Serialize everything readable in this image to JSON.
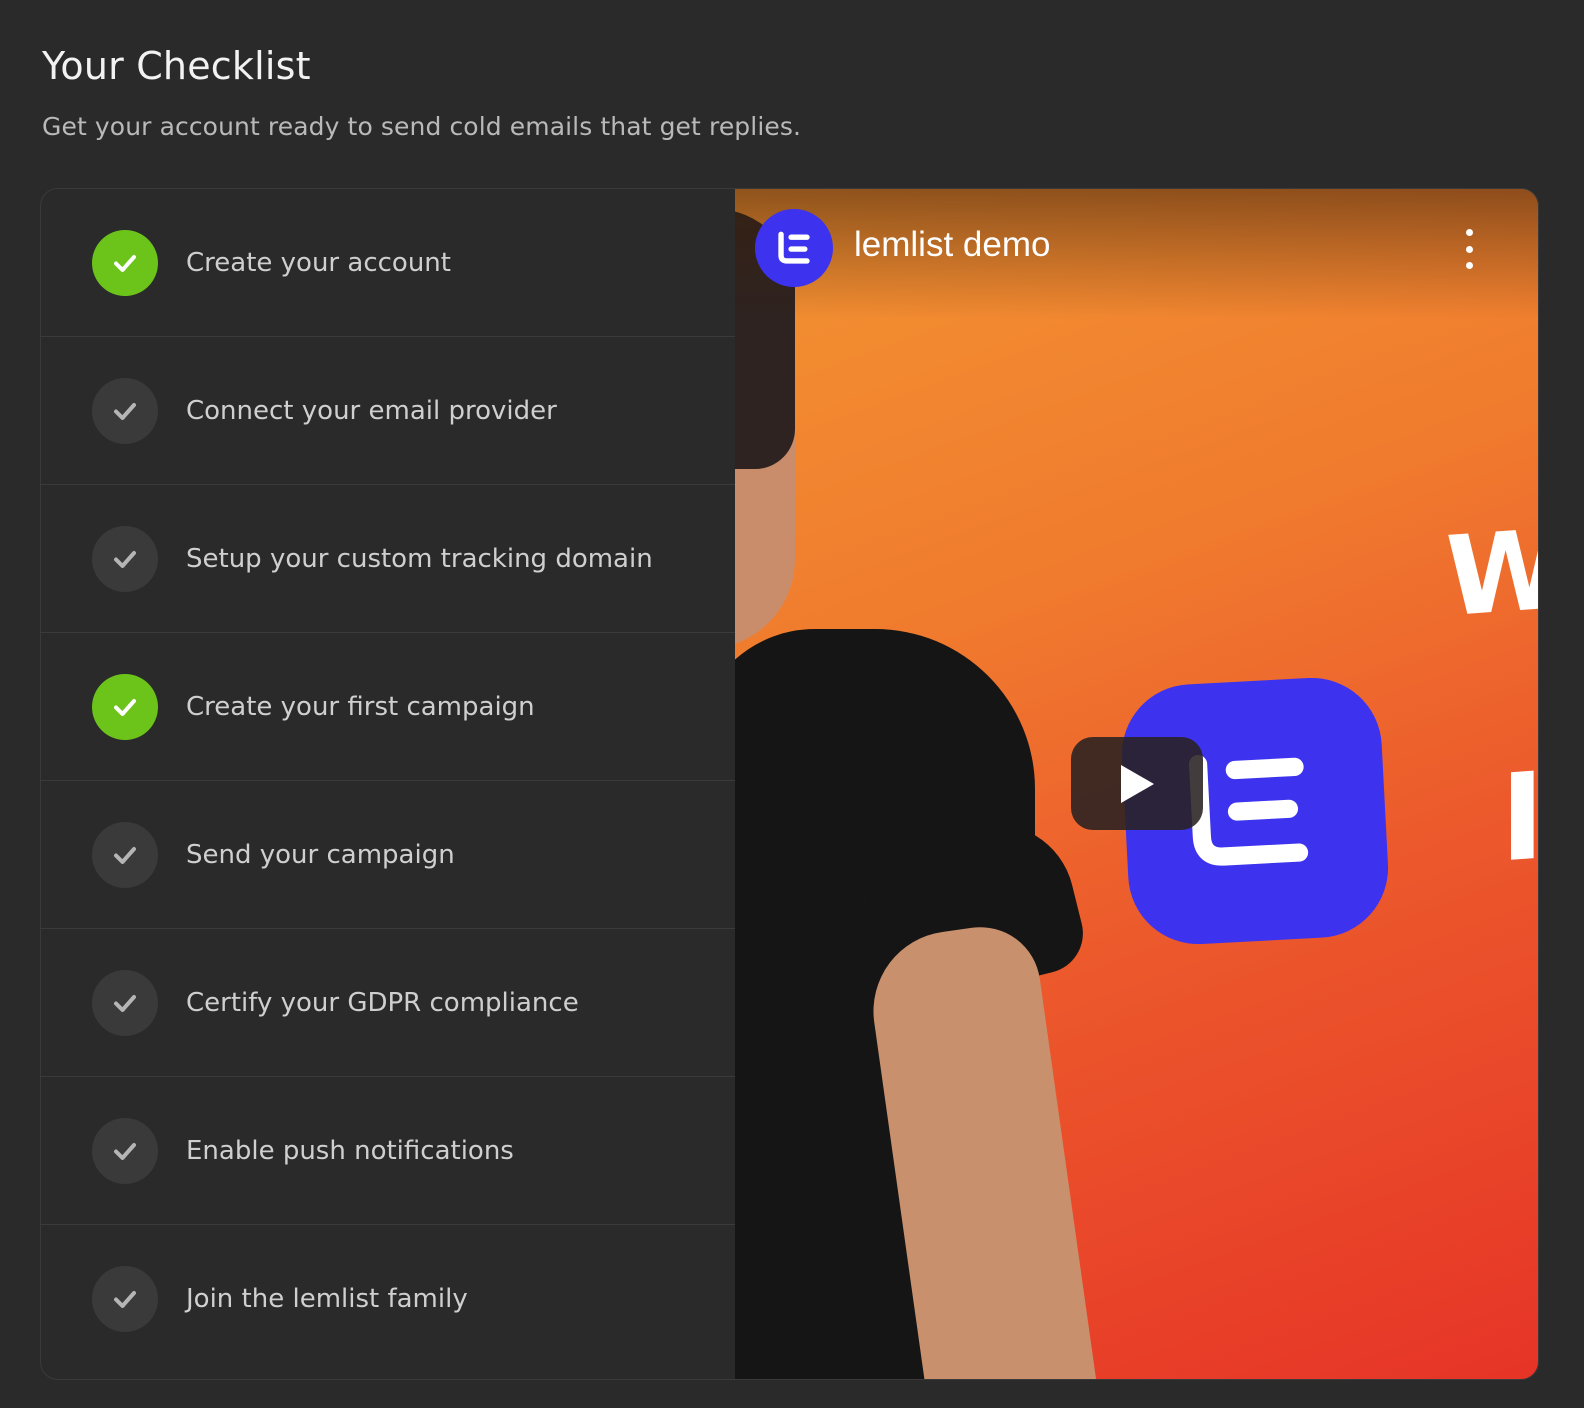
{
  "header": {
    "title": "Your Checklist",
    "subtitle": "Get your account ready to send cold emails that get replies."
  },
  "checklist": {
    "items": [
      {
        "label": "Create your account",
        "completed": true
      },
      {
        "label": "Connect your email provider",
        "completed": false
      },
      {
        "label": "Setup your custom tracking domain",
        "completed": false
      },
      {
        "label": "Create your first campaign",
        "completed": true
      },
      {
        "label": "Send your campaign",
        "completed": false
      },
      {
        "label": "Certify your GDPR compliance",
        "completed": false
      },
      {
        "label": "Enable push notifications",
        "completed": false
      },
      {
        "label": "Join the lemlist family",
        "completed": false
      }
    ]
  },
  "video": {
    "title": "lemlist demo",
    "channel_icon": "lemlist-logo-icon",
    "play_icon": "play-icon",
    "menu_icon": "more-vertical-icon"
  },
  "colors": {
    "background": "#2a2a2b",
    "completed": "#6cc41b",
    "pending": "#3a3a3b",
    "brand": "#3d33ef"
  }
}
